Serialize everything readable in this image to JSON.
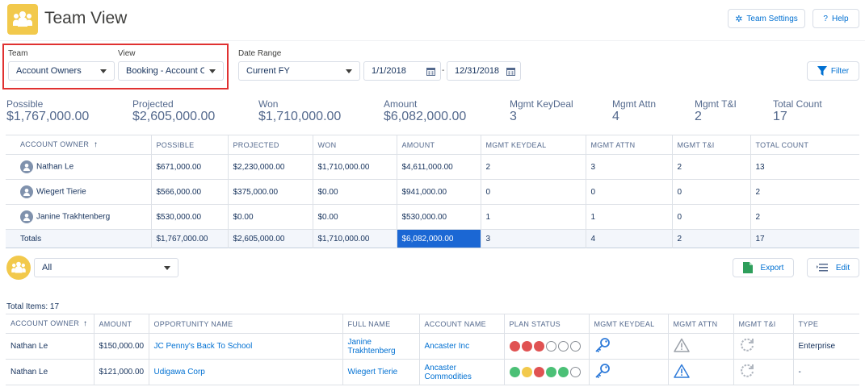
{
  "header": {
    "title": "Team View",
    "team_settings_label": "Team Settings",
    "help_label": "Help"
  },
  "filters": {
    "team_label": "Team",
    "team_value": "Account Owners",
    "view_label": "View",
    "view_value": "Booking - Account Ov",
    "date_range_label": "Date Range",
    "date_range_value": "Current FY",
    "start_date": "1/1/2018",
    "date_separator": "-",
    "end_date": "12/31/2018",
    "filter_label": "Filter"
  },
  "summary": [
    {
      "label": "Possible",
      "value": "$1,767,000.00"
    },
    {
      "label": "Projected",
      "value": "$2,605,000.00"
    },
    {
      "label": "Won",
      "value": "$1,710,000.00"
    },
    {
      "label": "Amount",
      "value": "$6,082,000.00"
    },
    {
      "label": "Mgmt KeyDeal",
      "value": "3"
    },
    {
      "label": "Mgmt Attn",
      "value": "4"
    },
    {
      "label": "Mgmt T&I",
      "value": "2"
    },
    {
      "label": "Total Count",
      "value": "17"
    }
  ],
  "summary_table": {
    "columns": [
      "ACCOUNT OWNER",
      "POSSIBLE",
      "PROJECTED",
      "WON",
      "AMOUNT",
      "MGMT KEYDEAL",
      "MGMT ATTN",
      "MGMT T&I",
      "TOTAL COUNT"
    ],
    "sort_indicator": "↑",
    "rows": [
      [
        "Nathan Le",
        "$671,000.00",
        "$2,230,000.00",
        "$1,710,000.00",
        "$4,611,000.00",
        "2",
        "3",
        "2",
        "13"
      ],
      [
        "Wiegert Tierie",
        "$566,000.00",
        "$375,000.00",
        "$0.00",
        "$941,000.00",
        "0",
        "0",
        "0",
        "2"
      ],
      [
        "Janine Trakhtenberg",
        "$530,000.00",
        "$0.00",
        "$0.00",
        "$530,000.00",
        "1",
        "1",
        "0",
        "2"
      ]
    ],
    "totals": [
      "Totals",
      "$1,767,000.00",
      "$2,605,000.00",
      "$1,710,000.00",
      "$6,082,000.00",
      "3",
      "4",
      "2",
      "17"
    ]
  },
  "list_controls": {
    "filter_value": "All",
    "export_label": "Export",
    "edit_label": "Edit",
    "total_items": "Total Items: 17"
  },
  "detail_table": {
    "columns": [
      "ACCOUNT OWNER",
      "AMOUNT",
      "OPPORTUNITY NAME",
      "FULL NAME",
      "ACCOUNT NAME",
      "PLAN STATUS",
      "MGMT KEYDEAL",
      "MGMT ATTN",
      "MGMT T&I",
      "TYPE"
    ],
    "sort_indicator": "↑",
    "rows": [
      {
        "owner": "Nathan Le",
        "amount": "$150,000.00",
        "opportunity": "JC Penny's Back To School",
        "full_name": "Janine Trakhtenberg",
        "account": "Ancaster Inc",
        "plan_status": [
          "#e05252",
          "#e05252",
          "#e05252",
          "empty",
          "empty",
          "empty"
        ],
        "keydeal_icon": "key-icon",
        "attn_icon": "warning-icon-gray",
        "ti_icon": "refresh-icon",
        "type": "Enterprise"
      },
      {
        "owner": "Nathan Le",
        "amount": "$121,000.00",
        "opportunity": "Udigawa Corp",
        "full_name": "Wiegert Tierie",
        "account": "Ancaster Commodities",
        "plan_status": [
          "#4bc076",
          "#f2c94c",
          "#e05252",
          "#4bc076",
          "#4bc076",
          "empty"
        ],
        "keydeal_icon": "key-icon",
        "attn_icon": "warning-icon-blue",
        "ti_icon": "refresh-icon",
        "type": "-"
      }
    ]
  },
  "colors": {
    "accent": "#0070d2",
    "highlight": "#1b67d4",
    "app_icon": "#f2c94c",
    "focus_border": "#e03131"
  }
}
